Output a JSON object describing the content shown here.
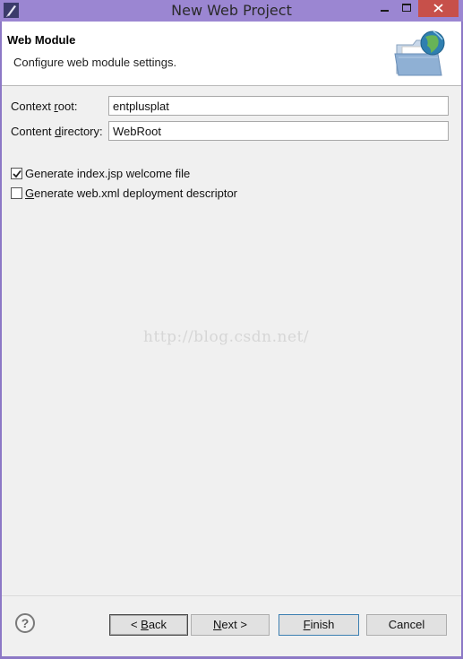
{
  "window": {
    "title": "New Web Project",
    "title_icon": "eclipse-pen-icon",
    "controls": [
      "minimize-icon",
      "maximize-icon",
      "close-icon"
    ]
  },
  "header": {
    "title": "Web Module",
    "description": "Configure web module settings.",
    "icon": "folder-globe-icon"
  },
  "form": {
    "context_root": {
      "label_pre": "Context ",
      "label_mnemonic": "r",
      "label_post": "oot:",
      "value": "entplusplat"
    },
    "content_directory": {
      "label_pre": "Content ",
      "label_mnemonic": "d",
      "label_post": "irectory:",
      "value": "WebRoot"
    },
    "generate_index": {
      "label": "Generate index.jsp welcome file",
      "checked": true
    },
    "generate_webxml": {
      "label_mnemonic": "G",
      "label_post": "enerate web.xml deployment descriptor",
      "checked": false
    }
  },
  "watermark": "http://blog.csdn.net/",
  "footer": {
    "help_icon": "help-question-icon",
    "back": {
      "pre": "< ",
      "mnemonic": "B",
      "post": "ack"
    },
    "next": {
      "mnemonic": "N",
      "post": "ext >"
    },
    "finish": {
      "mnemonic": "F",
      "post": "inish"
    },
    "cancel": "Cancel"
  },
  "colors": {
    "titlebar": "#9b86d2",
    "close_button": "#c7504a",
    "dialog_bg": "#f0f0f0",
    "header_bg": "#ffffff",
    "default_button_border": "#3c7fb1"
  }
}
